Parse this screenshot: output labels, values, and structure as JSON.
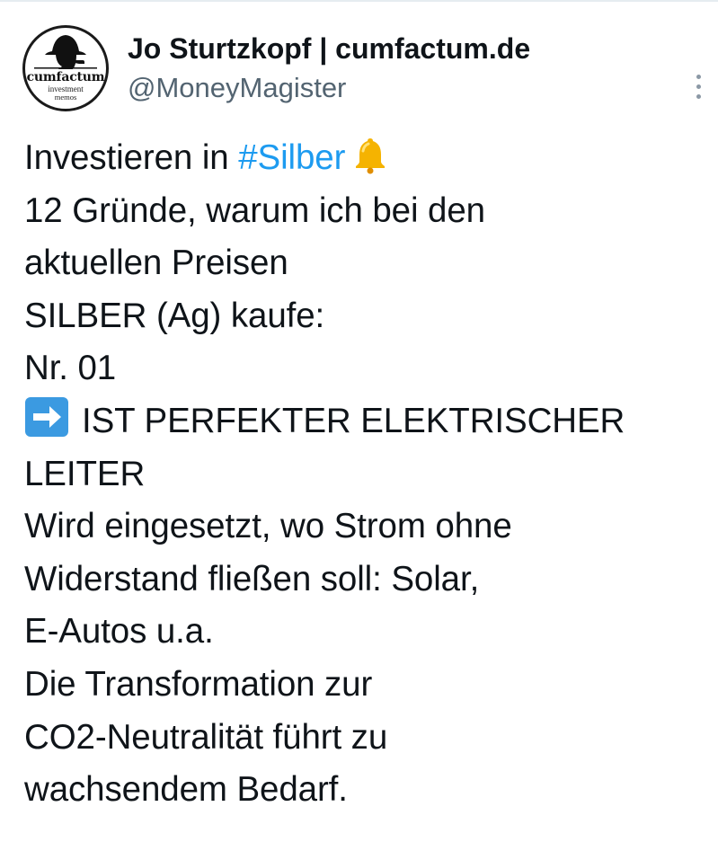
{
  "header": {
    "display_name": "Jo Sturtzkopf | cumfactum.de",
    "handle": "@MoneyMagister",
    "avatar": {
      "brand": "cumfactum",
      "sub_line_1": "investment",
      "sub_line_2": "memos",
      "icon": "detective-silhouette-icon"
    },
    "more_icon": "more-vertical-icon"
  },
  "tweet": {
    "line1_prefix": "Investieren in ",
    "hashtag": "#Silber",
    "bell_icon": "bell-icon",
    "line2": "12 Gründe, warum ich bei den",
    "line3": "aktuellen Preisen",
    "line4": "SILBER (Ag) kaufe:",
    "line5": "Nr. 01",
    "arrow_icon": "right-arrow-icon",
    "line6": "IST PERFEKTER ELEKTRISCHER",
    "line7": "LEITER",
    "line8": "Wird eingesetzt, wo Strom ohne",
    "line9": "Widerstand fließen soll: Solar,",
    "line10": "E-Autos u.a.",
    "line11": "Die Transformation zur",
    "line12": "CO2-Neutralität führt zu",
    "line13": "wachsendem Bedarf."
  },
  "colors": {
    "text": "#0f1419",
    "secondary_text": "#536471",
    "hashtag": "#1d9bf0",
    "bell": "#f5b301",
    "arrow_tile": "#3b9ae1"
  }
}
